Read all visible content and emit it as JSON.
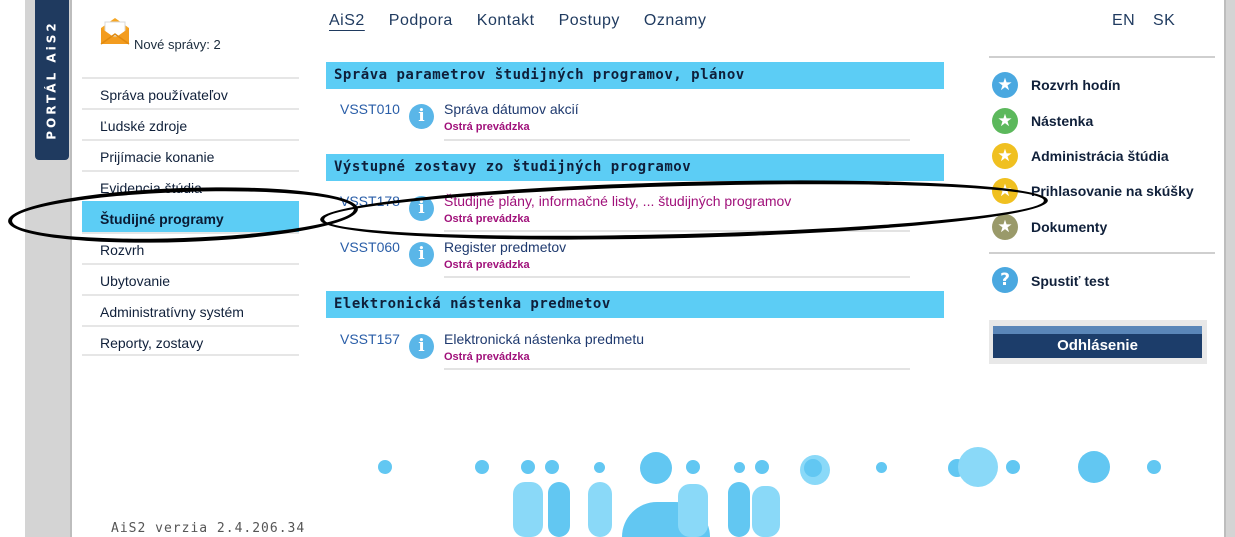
{
  "portal": {
    "label": "PORTÁL AiS2"
  },
  "messages": {
    "text": "Nové správy: 2",
    "icon": "envelope-icon"
  },
  "left_menu": {
    "items": [
      {
        "label": "Správa používateľov"
      },
      {
        "label": "Ľudské zdroje"
      },
      {
        "label": "Prijímacie konanie"
      },
      {
        "label": "Evidencia štúdia"
      },
      {
        "label": "Študijné programy",
        "active": true
      },
      {
        "label": "Rozvrh"
      },
      {
        "label": "Ubytovanie"
      },
      {
        "label": "Administratívny systém"
      },
      {
        "label": "Reporty, zostavy"
      }
    ]
  },
  "top_nav": {
    "links": [
      {
        "label": "AiS2",
        "active": true
      },
      {
        "label": "Podpora"
      },
      {
        "label": "Kontakt"
      },
      {
        "label": "Postupy"
      },
      {
        "label": "Oznamy"
      }
    ],
    "languages": [
      "EN",
      "SK"
    ]
  },
  "sections": [
    {
      "title": "Správa parametrov študijných programov, plánov",
      "apps": [
        {
          "code": "VSST010",
          "title": "Správa dátumov akcií",
          "subtitle": "Ostrá prevádzka",
          "visited": false
        }
      ]
    },
    {
      "title": "Výstupné zostavy zo študijných programov",
      "apps": [
        {
          "code": "VSST178",
          "title": "Študijné plány, informačné listy, ... študijných programov",
          "subtitle": "Ostrá prevádzka",
          "visited": true
        },
        {
          "code": "VSST060",
          "title": "Register predmetov",
          "subtitle": "Ostrá prevádzka",
          "visited": false
        }
      ]
    },
    {
      "title": "Elektronická nástenka predmetov",
      "apps": [
        {
          "code": "VSST157",
          "title": "Elektronická nástenka predmetu",
          "subtitle": "Ostrá prevádzka",
          "visited": false
        }
      ]
    }
  ],
  "right_menu": {
    "items": [
      {
        "label": "Rozvrh hodín",
        "icon": "star-icon",
        "color": "#4aa8e0"
      },
      {
        "label": "Nástenka",
        "icon": "star-icon",
        "color": "#5cb85c"
      },
      {
        "label": "Administrácia štúdia",
        "icon": "star-icon",
        "color": "#f0c020"
      },
      {
        "label": "Prihlasovanie na skúšky",
        "icon": "star-icon",
        "color": "#f0c020"
      },
      {
        "label": "Dokumenty",
        "icon": "star-icon",
        "color": "#9a9a6a"
      }
    ],
    "test": {
      "label": "Spustiť test",
      "icon": "question-icon",
      "color": "#4aa8e0"
    },
    "logout": "Odhlásenie"
  },
  "version": "AiS2 verzia 2.4.206.34",
  "colors": {
    "accent": "#5ccdf5",
    "navy": "#1c3d6a",
    "visited": "#a0107a"
  }
}
